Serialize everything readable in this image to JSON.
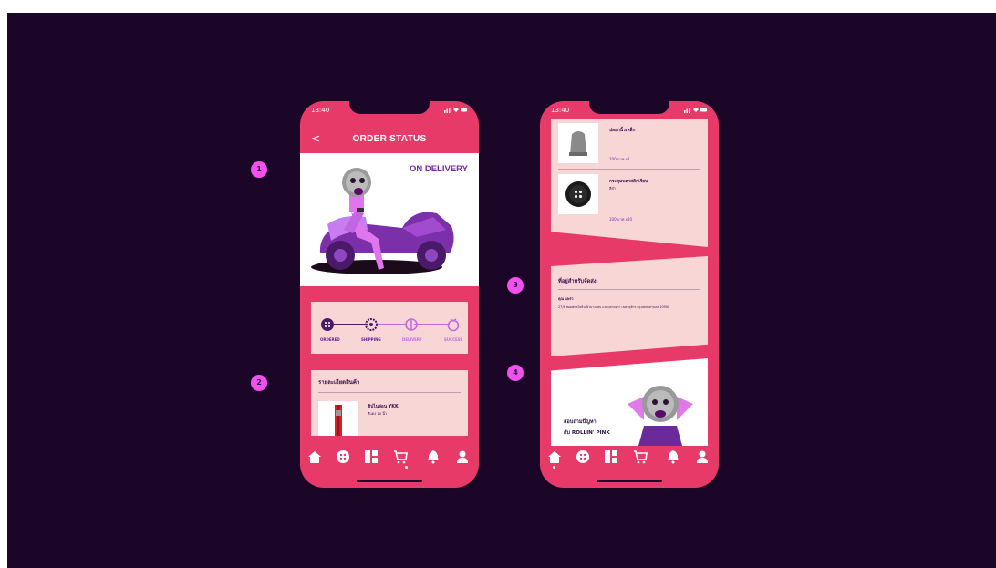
{
  "colors": {
    "background": "#1c0628",
    "phone_frame": "#e83a68",
    "card": "#f8d6d6",
    "accent_purple": "#7a27a8",
    "badge": "#f251ed"
  },
  "badges": [
    "1",
    "2",
    "3",
    "4"
  ],
  "phone1": {
    "status_time": "13:40",
    "back_label": "<",
    "title": "ORDER STATUS",
    "hero_label": "ON DELIVERY",
    "steps": [
      {
        "label": "ORDERED",
        "icon": "button-icon"
      },
      {
        "label": "SHIPPING",
        "icon": "gear-icon"
      },
      {
        "label": "DELIVERY",
        "icon": "delivery-icon"
      },
      {
        "label": "SUCCESS",
        "icon": "ring-icon"
      }
    ],
    "details_title": "รายละเอียดสินค้า",
    "item": {
      "name": "ซิปไนล่อน YKK",
      "sub": "สีแดง 10 นิ้ว"
    }
  },
  "phone2": {
    "status_time": "13:40",
    "items": [
      {
        "name": "ปลอกนิ้วเหล็ก",
        "sub": "",
        "price": "100 บาท x2",
        "icon": "thimble-icon"
      },
      {
        "name": "กระดุมพลาสติกเรียบ",
        "sub": "สีดำ",
        "price": "100 บาท x20",
        "icon": "button-icon"
      }
    ],
    "address_title": "ที่อยู่สำหรับจัดส่ง",
    "address_name": "คุณ แพรว",
    "address_line": "27/4 ซอยพหลโยธิน นิวบางแสน แขวงลาดยาว เขตจตุจักร กรุงเทพมหานคร 10900",
    "help_line1": "สอบถามปัญหา",
    "help_line2": "กับ ROLLIN' PINK"
  },
  "tabbar": [
    "home-icon",
    "button-icon",
    "catalog-icon",
    "cart-icon",
    "bell-icon",
    "user-icon"
  ]
}
